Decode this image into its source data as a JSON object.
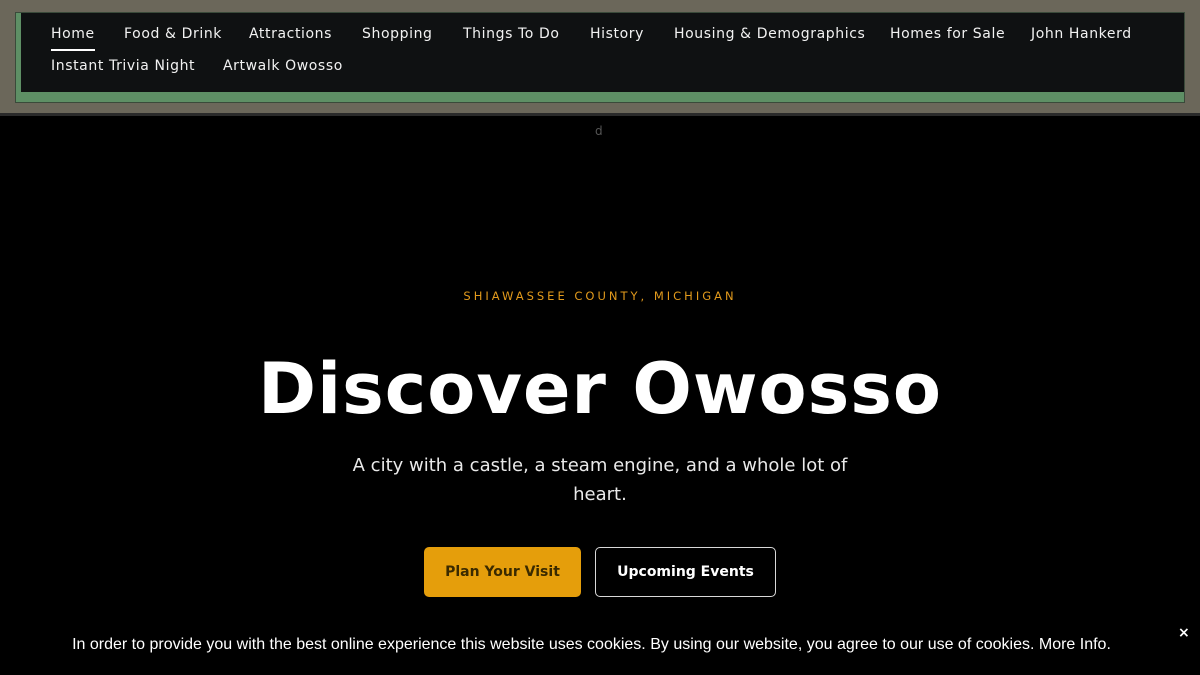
{
  "nav": {
    "items": [
      {
        "label": "Home",
        "active": true
      },
      {
        "label": "Food & Drink"
      },
      {
        "label": "Attractions"
      },
      {
        "label": "Shopping"
      },
      {
        "label": "Things To Do"
      },
      {
        "label": "History"
      },
      {
        "label": "Housing & Demographics"
      },
      {
        "label": "Homes for Sale"
      },
      {
        "label": "John Hankerd"
      },
      {
        "label": "Instant Trivia Night"
      },
      {
        "label": "Artwalk Owosso"
      }
    ]
  },
  "stray_glyph": "d",
  "hero": {
    "eyebrow": "SHIAWASSEE COUNTY, MICHIGAN",
    "title": "Discover Owosso",
    "subtitle": "A city with a castle, a steam engine, and a whole lot of heart.",
    "primary_button": "Plan Your Visit",
    "secondary_button": "Upcoming Events"
  },
  "cookie": {
    "text": "In order to provide you with the best online experience this website uses cookies. By using our website, you agree to our use of cookies. More Info.",
    "close": "×"
  },
  "colors": {
    "accent": "#e29a1c",
    "button_primary": "#e59e0b",
    "nav_frame": "#5e8f65",
    "top_band": "#6b675a"
  }
}
